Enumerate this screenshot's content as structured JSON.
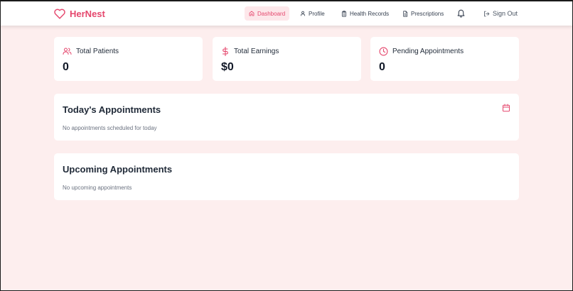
{
  "app": {
    "brand": "HerNest",
    "accent": "#e5476d",
    "background": "#fdeeee"
  },
  "nav": {
    "items": [
      {
        "label": "Dashboard",
        "icon": "home-icon",
        "active": true
      },
      {
        "label": "Profile",
        "icon": "user-icon"
      },
      {
        "label": "Health Records",
        "icon": "clipboard-icon"
      },
      {
        "label": "Prescriptions",
        "icon": "file-text-icon"
      }
    ],
    "notifications_icon": "bell-icon",
    "sign_out": "Sign Out"
  },
  "stats": [
    {
      "label": "Total Patients",
      "value": "0",
      "icon": "users-icon"
    },
    {
      "label": "Total Earnings",
      "value": "$0",
      "icon": "dollar-icon"
    },
    {
      "label": "Pending Appointments",
      "value": "0",
      "icon": "clock-icon"
    }
  ],
  "today": {
    "title": "Today's Appointments",
    "empty": "No appointments scheduled for today",
    "icon": "calendar-icon"
  },
  "upcoming": {
    "title": "Upcoming Appointments",
    "empty": "No upcoming appointments"
  }
}
